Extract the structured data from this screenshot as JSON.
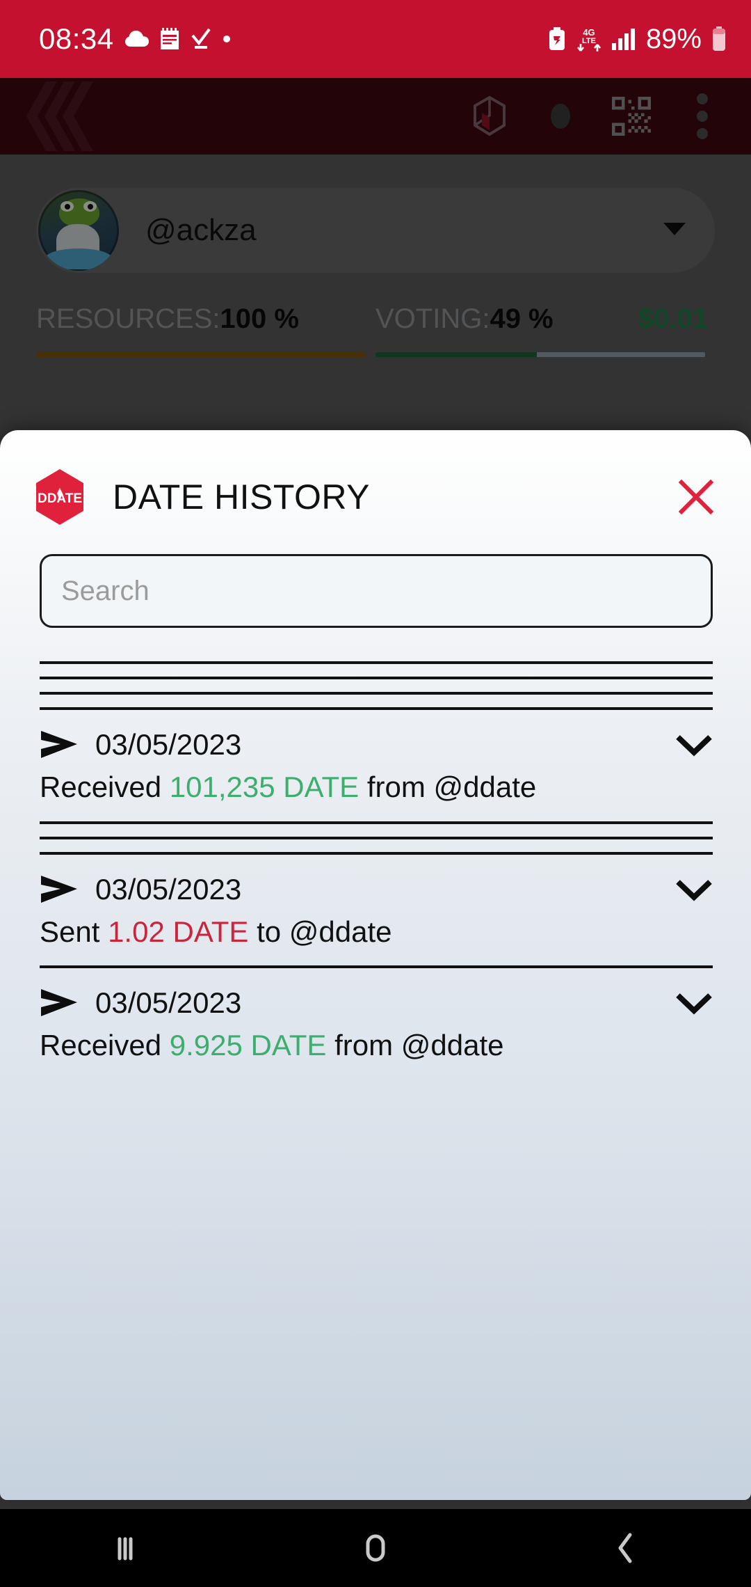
{
  "status_bar": {
    "time": "08:34",
    "battery_percent": "89%",
    "network": "4G LTE",
    "left_icons": [
      "cloud-icon",
      "calendar-icon",
      "check-download-icon",
      "dot-icon"
    ],
    "right_icons": [
      "battery-saver-icon",
      "network-4g-lte-icon",
      "signal-bars-icon",
      "battery-icon"
    ],
    "background_color": "#c3112f"
  },
  "app_header": {
    "logo": "hive-logo",
    "actions": [
      "cube-icon",
      "circle-icon",
      "qr-code-icon",
      "overflow-menu-icon"
    ],
    "background_color": "#3b0711"
  },
  "account": {
    "name": "@ackza",
    "avatar": "pepe-avatar",
    "caret": "caret-down-icon"
  },
  "meters": [
    {
      "label": "RESOURCES:",
      "value": "100 %",
      "percent": 100,
      "color": "#7a5410"
    },
    {
      "label": "VOTING:",
      "value": "49 %",
      "percent": 49,
      "color": "#1c5d36",
      "usd": "$0.01",
      "usd_color": "#1d7a46"
    }
  ],
  "modal": {
    "logo_text": "DDATE",
    "title": "DATE HISTORY",
    "close_label": "✕",
    "search": {
      "placeholder": "Search",
      "value": ""
    },
    "transactions": [
      {
        "date": "03/05/2023",
        "action": "Received",
        "amount": "101,235 DATE",
        "preposition": "from",
        "counterparty": "@ddate",
        "direction": "in"
      },
      {
        "date": "03/05/2023",
        "action": "Sent",
        "amount": "1.02 DATE",
        "preposition": "to",
        "counterparty": "@ddate",
        "direction": "out"
      },
      {
        "date": "03/05/2023",
        "action": "Received",
        "amount": "9.925 DATE",
        "preposition": "from",
        "counterparty": "@ddate",
        "direction": "in"
      }
    ]
  },
  "nav_bar": {
    "buttons": [
      "recents-icon",
      "home-icon",
      "back-icon"
    ]
  }
}
